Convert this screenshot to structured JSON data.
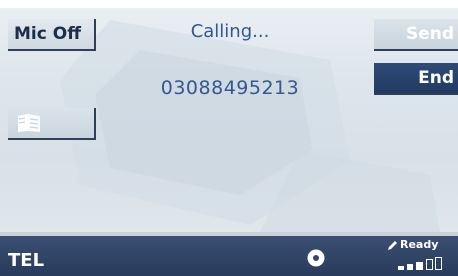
{
  "screen": {
    "mode": "TEL",
    "status": "Ready",
    "signal_level": "3 of 5"
  },
  "left_buttons": {
    "mic_off": "Mic Off",
    "phonebook_icon": "phonebook-icon"
  },
  "right_buttons": {
    "send": "Send",
    "end": "End"
  },
  "call": {
    "state": "Calling...",
    "number": "03088495213"
  },
  "status_bar": {
    "mode_label": "TEL",
    "ready_label": "Ready",
    "disc_icon": "cd-icon",
    "pen_icon": "pen-icon",
    "signal_icon": "signal-bars-icon"
  },
  "colors": {
    "accent_blue": "#34588f",
    "end_button": "#2e4a76",
    "status_bar": "#2f4466"
  }
}
